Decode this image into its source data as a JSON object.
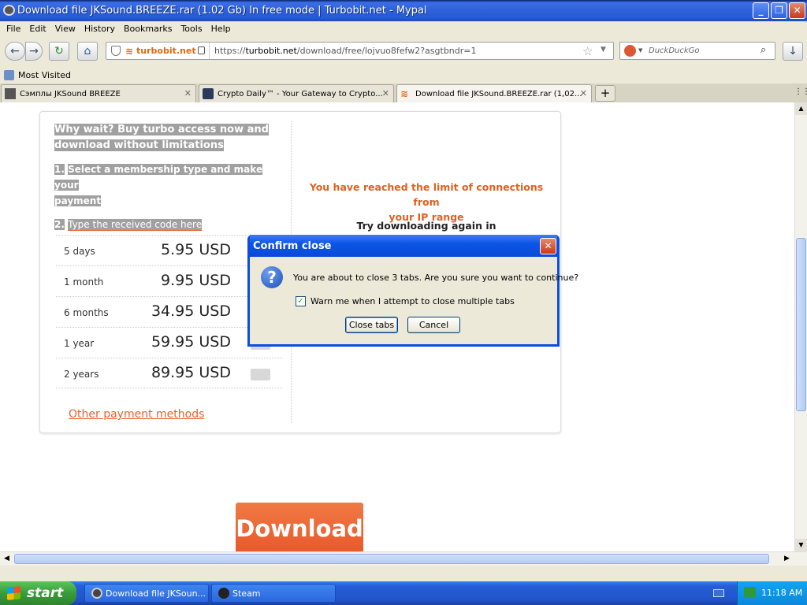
{
  "window": {
    "title": "Download file JKSound.BREEZE.rar (1.02 Gb) In free mode | Turbobit.net - Mypal"
  },
  "menu": [
    "File",
    "Edit",
    "View",
    "History",
    "Bookmarks",
    "Tools",
    "Help"
  ],
  "navbar": {
    "site_identity": "turbobit.net",
    "url_prefix": "https://",
    "url_host": "turbobit.net",
    "url_path": "/download/free/lojvuo8fefw2?asgtbndr=1",
    "search_engine": "DuckDuckGo"
  },
  "bookmarks": {
    "most_visited": "Most Visited"
  },
  "tabs": [
    {
      "label": "Сэмплы JKSound BREEZE",
      "active": false
    },
    {
      "label": "Crypto Daily™ - Your Gateway to Crypto...",
      "active": false
    },
    {
      "label": "Download file JKSound.BREEZE.rar (1,02...",
      "active": true
    }
  ],
  "page": {
    "promo_line1": "Why wait? Buy turbo access now and",
    "promo_line2": "download without limitations",
    "step1_num": "1.",
    "step1_line1": "Select a membership type and make your",
    "step1_line2": "payment",
    "step2_num": "2.",
    "step2_text": "Type the received code here",
    "prices": [
      {
        "label": "5 days",
        "value": "5.95 USD"
      },
      {
        "label": "1 month",
        "value": "9.95 USD"
      },
      {
        "label": "6 months",
        "value": "34.95 USD"
      },
      {
        "label": "1 year",
        "value": "59.95 USD"
      },
      {
        "label": "2 years",
        "value": "89.95 USD"
      }
    ],
    "other_payment": "Other payment methods",
    "limit_line1": "You have reached the limit of connections from",
    "limit_line2": "your IP range",
    "try_again": "Try downloading again in",
    "download_button": "Download"
  },
  "dialog": {
    "title": "Confirm close",
    "message": "You are about to close 3 tabs. Are you sure you want to continue?",
    "checkbox_label": "Warn me when I attempt to close multiple tabs",
    "checkbox_checked": true,
    "close_tabs_label": "Close tabs",
    "cancel_label": "Cancel"
  },
  "taskbar": {
    "start_label": "start",
    "items": [
      {
        "label": "Download file JKSoun..."
      },
      {
        "label": "Steam"
      }
    ],
    "clock": "11:18 AM"
  },
  "colors": {
    "accent_orange": "#e8622a",
    "xp_blue": "#245ed8",
    "limit_text": "#e06020"
  }
}
